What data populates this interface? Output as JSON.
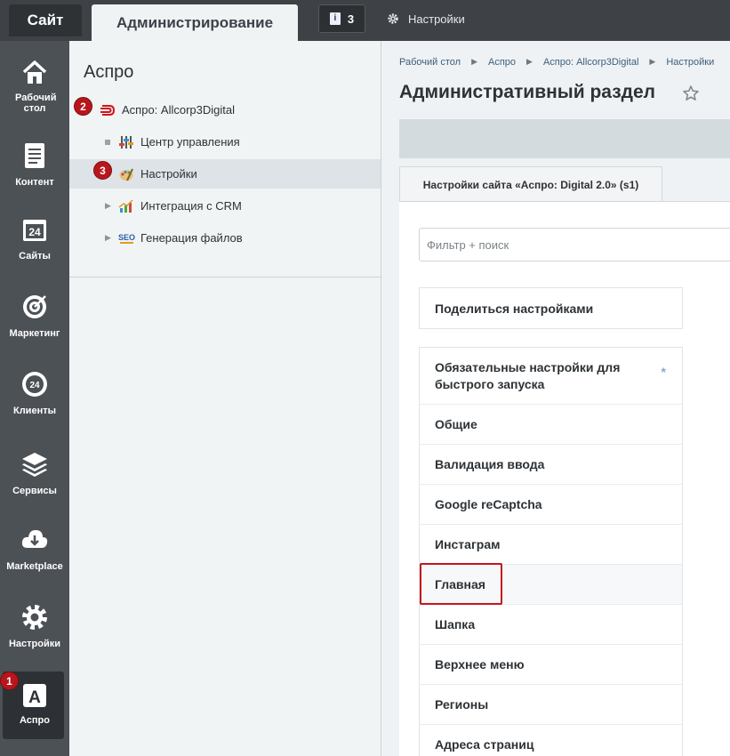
{
  "topbar": {
    "site_tab": "Сайт",
    "admin_tab": "Администрирование",
    "notifications_count": "3",
    "settings_label": "Настройки"
  },
  "leftbar": {
    "items": [
      {
        "label": "Рабочий стол",
        "icon": "home-icon"
      },
      {
        "label": "Контент",
        "icon": "document-icon"
      },
      {
        "label": "Сайты",
        "icon": "calendar-24-icon"
      },
      {
        "label": "Маркетинг",
        "icon": "target-icon"
      },
      {
        "label": "Клиенты",
        "icon": "clients-24-icon"
      },
      {
        "label": "Сервисы",
        "icon": "layers-icon"
      },
      {
        "label": "Marketplace",
        "icon": "cloud-download-icon"
      },
      {
        "label": "Настройки",
        "icon": "gear-icon"
      },
      {
        "label": "Аспро",
        "icon": "aspro-a-icon"
      }
    ],
    "active_badge": "1"
  },
  "menu": {
    "title": "Аспро",
    "items": [
      {
        "label": "Аспро: Allcorp3Digital",
        "badge": "2"
      },
      {
        "label": "Центр управления"
      },
      {
        "label": "Настройки",
        "badge": "3"
      },
      {
        "label": "Интеграция с CRM"
      },
      {
        "label": "Генерация файлов"
      }
    ]
  },
  "main": {
    "breadcrumbs": [
      "Рабочий стол",
      "Аспро",
      "Аспро: Allcorp3Digital",
      "Настройки"
    ],
    "title": "Административный раздел",
    "tab_label": "Настройки сайта «Аспро: Digital 2.0» (s1)",
    "search_placeholder": "Фильтр + поиск",
    "share_label": "Поделиться настройками",
    "sections": [
      "Обязательные настройки для быстрого запуска",
      "Общие",
      "Валидация ввода",
      "Google reCaptcha",
      "Инстаграм",
      "Главная",
      "Шапка",
      "Верхнее меню",
      "Регионы",
      "Адреса страниц"
    ],
    "required_marker": "*"
  },
  "colors": {
    "topbar_bg": "#3e4145",
    "sidebar_bg": "#4c5156",
    "badge_red": "#b8161c",
    "highlight_red": "#c5151c",
    "link_blue": "#3d5d7a"
  }
}
